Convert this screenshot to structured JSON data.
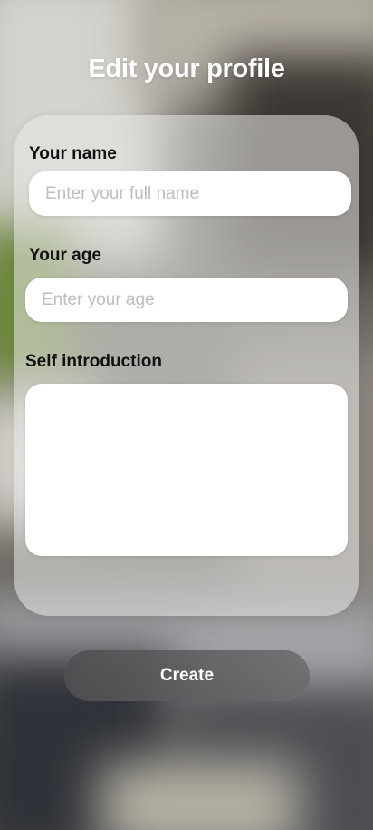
{
  "header": {
    "title": "Edit your profile"
  },
  "form": {
    "name_label": "Your name",
    "name_placeholder": "Enter your full name",
    "age_label": "Your age",
    "age_placeholder": "Enter your age",
    "intro_label": "Self introduction",
    "intro_value": ""
  },
  "actions": {
    "create_label": "Create"
  },
  "colors": {
    "card_background": "#e8e8e6",
    "button_background": "#5a5a5c",
    "title_text": "#ffffff",
    "label_text": "#111111",
    "placeholder_text": "#bdbdbd"
  }
}
